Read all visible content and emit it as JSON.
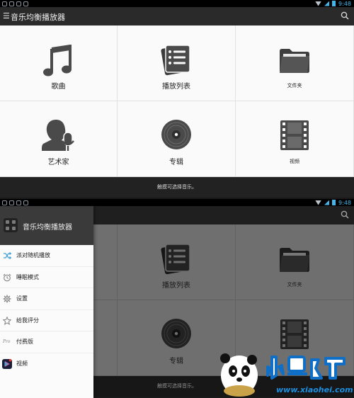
{
  "status": {
    "time_top": "9:48",
    "time_bottom": "9:48"
  },
  "appbar": {
    "title": "音乐均衡播放器"
  },
  "tiles": [
    {
      "label": "歌曲",
      "icon": "music-note-icon"
    },
    {
      "label": "播放列表",
      "icon": "playlist-icon"
    },
    {
      "label": "文件夹",
      "icon": "folder-icon"
    },
    {
      "label": "艺术家",
      "icon": "artist-icon"
    },
    {
      "label": "专辑",
      "icon": "album-disc-icon"
    },
    {
      "label": "视频",
      "icon": "video-film-icon"
    }
  ],
  "hint": "触摸可选择音乐。",
  "drawer": {
    "title": "音乐均衡播放器",
    "items": [
      {
        "label": "派对随机播放",
        "icon": "shuffle-icon"
      },
      {
        "label": "睡眠模式",
        "icon": "alarm-clock-icon"
      },
      {
        "label": "设置",
        "icon": "gear-icon"
      },
      {
        "label": "给我评分",
        "icon": "star-icon"
      },
      {
        "label": "付费版",
        "icon": "pro-icon"
      },
      {
        "label": "视频",
        "icon": "video-app-icon"
      }
    ]
  },
  "watermark": {
    "brand": "小黑游戏",
    "url": "www.xiaohei.com"
  },
  "colors": {
    "accent": "#45b4e8",
    "drawer_header": "#3a3a3a",
    "hint_bar": "#222222"
  }
}
